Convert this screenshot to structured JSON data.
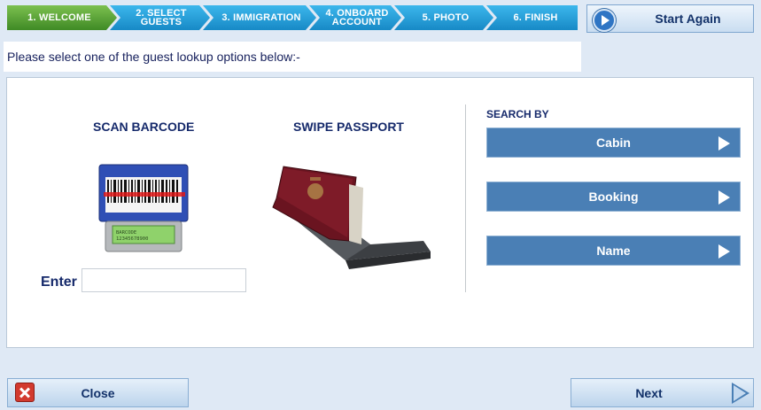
{
  "wizard": {
    "steps": [
      {
        "lines": [
          "1. Welcome"
        ],
        "color": "#4a9a2e"
      },
      {
        "lines": [
          "2. Select",
          "Guests"
        ],
        "color": "#1aa0da"
      },
      {
        "lines": [
          "3. Immigration"
        ],
        "color": "#1aa0da"
      },
      {
        "lines": [
          "4. Onboard",
          "Account"
        ],
        "color": "#1aa0da"
      },
      {
        "lines": [
          "5. Photo"
        ],
        "color": "#1aa0da"
      },
      {
        "lines": [
          "6. Finish"
        ],
        "color": "#1aa0da"
      }
    ]
  },
  "header": {
    "start_again_label": "Start Again"
  },
  "instruction": "Please select one of the guest lookup options below:-",
  "scan": {
    "heading": "SCAN BARCODE",
    "barcode_text_line1": "BARCODE",
    "barcode_text_line2": "12345678900",
    "enter_label": "Enter",
    "enter_value": ""
  },
  "swipe": {
    "heading": "SWIPE PASSPORT"
  },
  "search": {
    "heading": "SEARCH BY",
    "options": [
      {
        "label": "Cabin"
      },
      {
        "label": "Booking"
      },
      {
        "label": "Name"
      }
    ]
  },
  "footer": {
    "close_label": "Close",
    "next_label": "Next"
  },
  "colors": {
    "accent_blue": "#4a7fb5",
    "step_green": "#4a9a2e",
    "step_blue": "#1aa0da",
    "heading_navy": "#162a6b"
  }
}
